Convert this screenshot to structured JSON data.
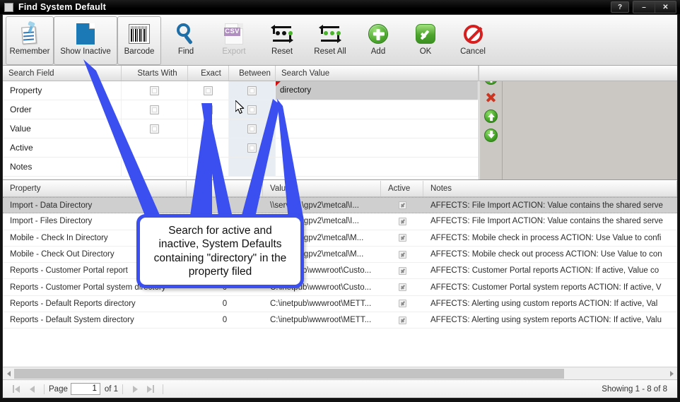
{
  "window": {
    "title": "Find System Default",
    "icon": "window-app-icon",
    "buttons": {
      "help": "?",
      "minimize": "–",
      "close": "✕"
    }
  },
  "toolbar": {
    "items": [
      {
        "label": "Remember",
        "icon": "pinned-note-icon",
        "framed": true,
        "disabled": false
      },
      {
        "label": "Show Inactive",
        "icon": "blue-document-icon",
        "framed": true,
        "disabled": false
      },
      {
        "label": "Barcode",
        "icon": "barcode-icon",
        "framed": true,
        "disabled": false
      },
      {
        "label": "Find",
        "icon": "magnifier-icon",
        "framed": false,
        "disabled": false
      },
      {
        "label": "Export",
        "icon": "csv-file-icon",
        "framed": false,
        "disabled": true
      },
      {
        "label": "Reset",
        "icon": "reset-arrows-icon",
        "framed": false,
        "disabled": false
      },
      {
        "label": "Reset All",
        "icon": "reset-arrows-icon",
        "framed": false,
        "disabled": false
      },
      {
        "label": "Add",
        "icon": "green-plus-icon",
        "framed": false,
        "disabled": false
      },
      {
        "label": "OK",
        "icon": "green-check-icon",
        "framed": false,
        "disabled": false
      },
      {
        "label": "Cancel",
        "icon": "red-no-entry-icon",
        "framed": false,
        "disabled": false
      }
    ]
  },
  "search_panel": {
    "columns": [
      "Search Field",
      "Starts With",
      "Exact",
      "Between",
      "Search Value"
    ],
    "rows": [
      {
        "field": "Property",
        "starts_with": false,
        "exact": false,
        "between": false,
        "value": "directory",
        "flagged": true
      },
      {
        "field": "Order",
        "starts_with": false,
        "exact": false,
        "between": false,
        "value": "",
        "flagged": false
      },
      {
        "field": "Value",
        "starts_with": false,
        "exact": false,
        "between": false,
        "value": "",
        "flagged": false
      },
      {
        "field": "Active",
        "starts_with": false,
        "exact": false,
        "between": false,
        "value": "",
        "flagged": false
      },
      {
        "field": "Notes",
        "starts_with": false,
        "exact": false,
        "between": false,
        "value": "",
        "flagged": false
      }
    ],
    "side_buttons": [
      {
        "name": "add-criteria-button",
        "icon": "green-plus-circle-icon"
      },
      {
        "name": "delete-criteria-button",
        "icon": "red-x-icon"
      },
      {
        "name": "move-up-button",
        "icon": "green-up-arrow-icon"
      },
      {
        "name": "move-down-button",
        "icon": "green-down-arrow-icon"
      }
    ]
  },
  "results": {
    "columns": [
      "Property",
      "",
      "Value",
      "Active",
      "Notes"
    ],
    "rows": [
      {
        "property": "Import - Data Directory",
        "order": "",
        "value": "\\\\server1\\gpv2\\metcal\\I...",
        "active": true,
        "notes": "AFFECTS: File Import ACTION: Value contains the shared serve",
        "selected": true
      },
      {
        "property": "Import - Files Directory",
        "order": "",
        "value": "\\\\server1\\gpv2\\metcal\\I...",
        "active": true,
        "notes": "AFFECTS: File Import ACTION: Value contains the shared serve",
        "selected": false
      },
      {
        "property": "Mobile - Check In Directory",
        "order": "",
        "value": "\\\\server1\\gpv2\\metcal\\M...",
        "active": true,
        "notes": "AFFECTS: Mobile check in process ACTION: Use Value to confi",
        "selected": false
      },
      {
        "property": "Mobile - Check Out Directory",
        "order": "",
        "value": "\\\\server1\\gpv2\\metcal\\M...",
        "active": true,
        "notes": "AFFECTS: Mobile check out process ACTION: Use Value to con",
        "selected": false
      },
      {
        "property": "Reports - Customer Portal report",
        "order": "",
        "value": "C:\\inetpub\\wwwroot\\Custo...",
        "active": true,
        "notes": "AFFECTS: Customer Portal reports ACTION: If active, Value co",
        "selected": false
      },
      {
        "property": "Reports - Customer Portal system directory",
        "order": "0",
        "value": "C:\\inetpub\\wwwroot\\Custo...",
        "active": true,
        "notes": "AFFECTS: Customer Portal system reports ACTION: If active, V",
        "selected": false
      },
      {
        "property": "Reports - Default Reports directory",
        "order": "0",
        "value": "C:\\inetpub\\wwwroot\\METT...",
        "active": true,
        "notes": "AFFECTS: Alerting using custom reports ACTION: If active, Val",
        "selected": false
      },
      {
        "property": "Reports - Default System directory",
        "order": "0",
        "value": "C:\\inetpub\\wwwroot\\METT...",
        "active": true,
        "notes": "AFFECTS: Alerting using system reports ACTION: If active, Valu",
        "selected": false
      }
    ]
  },
  "statusbar": {
    "page_label": "Page",
    "page_value": "1",
    "of_label": "of 1",
    "showing": "Showing 1 - 8 of 8"
  },
  "annotation": {
    "text": "Search for active and inactive, System Defaults containing \"directory\" in the property filed",
    "color": "#3b4ff0"
  }
}
